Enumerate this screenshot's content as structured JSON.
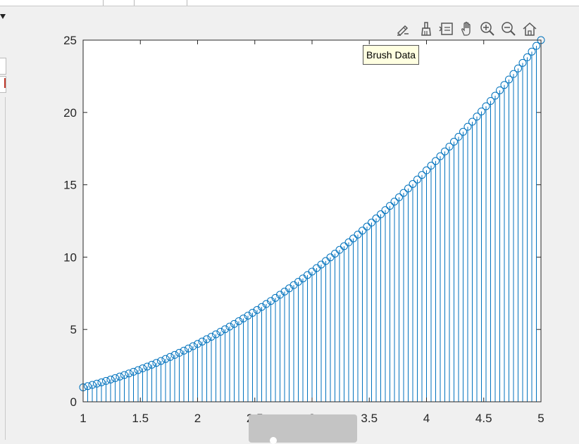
{
  "tooltip": {
    "text": "Brush Data"
  },
  "toolbar": {
    "icons": [
      "edit-plot-icon",
      "brush-icon",
      "data-tips-icon",
      "pan-icon",
      "zoom-in-icon",
      "zoom-out-icon",
      "restore-view-icon"
    ],
    "color": "#555555"
  },
  "colors": {
    "series": "#0072bd",
    "axis": "#262626",
    "background": "#f0f0f0",
    "plot_area": "#ffffff"
  },
  "chart_data": {
    "type": "stem",
    "title": "",
    "xlabel": "",
    "ylabel": "",
    "xlim": [
      1,
      5
    ],
    "ylim": [
      0,
      25
    ],
    "xticks": [
      1,
      1.5,
      2,
      2.5,
      3,
      3.5,
      4,
      4.5,
      5
    ],
    "xtick_labels": [
      "1",
      "1.5",
      "2",
      "2.5",
      "3",
      "3.5",
      "4",
      "4.5",
      "5"
    ],
    "yticks": [
      0,
      5,
      10,
      15,
      20,
      25
    ],
    "ytick_labels": [
      "0",
      "5",
      "10",
      "15",
      "20",
      "25"
    ],
    "grid": false,
    "marker": "open-circle",
    "x": [
      1.0,
      1.04,
      1.08,
      1.12,
      1.16,
      1.2,
      1.24,
      1.28,
      1.32,
      1.36,
      1.4,
      1.44,
      1.48,
      1.52,
      1.56,
      1.6,
      1.64,
      1.68,
      1.72,
      1.76,
      1.8,
      1.84,
      1.88,
      1.92,
      1.96,
      2.0,
      2.04,
      2.08,
      2.12,
      2.16,
      2.2,
      2.24,
      2.28,
      2.32,
      2.36,
      2.4,
      2.44,
      2.48,
      2.52,
      2.56,
      2.6,
      2.64,
      2.68,
      2.72,
      2.76,
      2.8,
      2.84,
      2.88,
      2.92,
      2.96,
      3.0,
      3.04,
      3.08,
      3.12,
      3.16,
      3.2,
      3.24,
      3.28,
      3.32,
      3.36,
      3.4,
      3.44,
      3.48,
      3.52,
      3.56,
      3.6,
      3.64,
      3.68,
      3.72,
      3.76,
      3.8,
      3.84,
      3.88,
      3.92,
      3.96,
      4.0,
      4.04,
      4.08,
      4.12,
      4.16,
      4.2,
      4.24,
      4.28,
      4.32,
      4.36,
      4.4,
      4.44,
      4.48,
      4.52,
      4.56,
      4.6,
      4.64,
      4.68,
      4.72,
      4.76,
      4.8,
      4.84,
      4.88,
      4.92,
      4.96,
      5.0
    ],
    "y": [
      1.0,
      1.082,
      1.166,
      1.254,
      1.346,
      1.44,
      1.538,
      1.638,
      1.742,
      1.85,
      1.96,
      2.074,
      2.19,
      2.31,
      2.434,
      2.56,
      2.69,
      2.822,
      2.958,
      3.098,
      3.24,
      3.386,
      3.534,
      3.686,
      3.842,
      4.0,
      4.162,
      4.326,
      4.494,
      4.666,
      4.84,
      5.018,
      5.198,
      5.382,
      5.57,
      5.76,
      5.954,
      6.15,
      6.35,
      6.554,
      6.76,
      6.97,
      7.182,
      7.398,
      7.618,
      7.84,
      8.066,
      8.294,
      8.526,
      8.762,
      9.0,
      9.242,
      9.486,
      9.734,
      9.986,
      10.24,
      10.498,
      10.758,
      11.022,
      11.29,
      11.56,
      11.834,
      12.11,
      12.39,
      12.674,
      12.96,
      13.25,
      13.542,
      13.838,
      14.138,
      14.44,
      14.746,
      15.054,
      15.366,
      15.682,
      16.0,
      16.322,
      16.646,
      16.974,
      17.306,
      17.64,
      17.978,
      18.318,
      18.662,
      19.01,
      19.36,
      19.714,
      20.07,
      20.43,
      20.794,
      21.16,
      21.53,
      21.902,
      22.278,
      22.658,
      23.04,
      23.426,
      23.814,
      24.206,
      24.602,
      25.0
    ]
  }
}
